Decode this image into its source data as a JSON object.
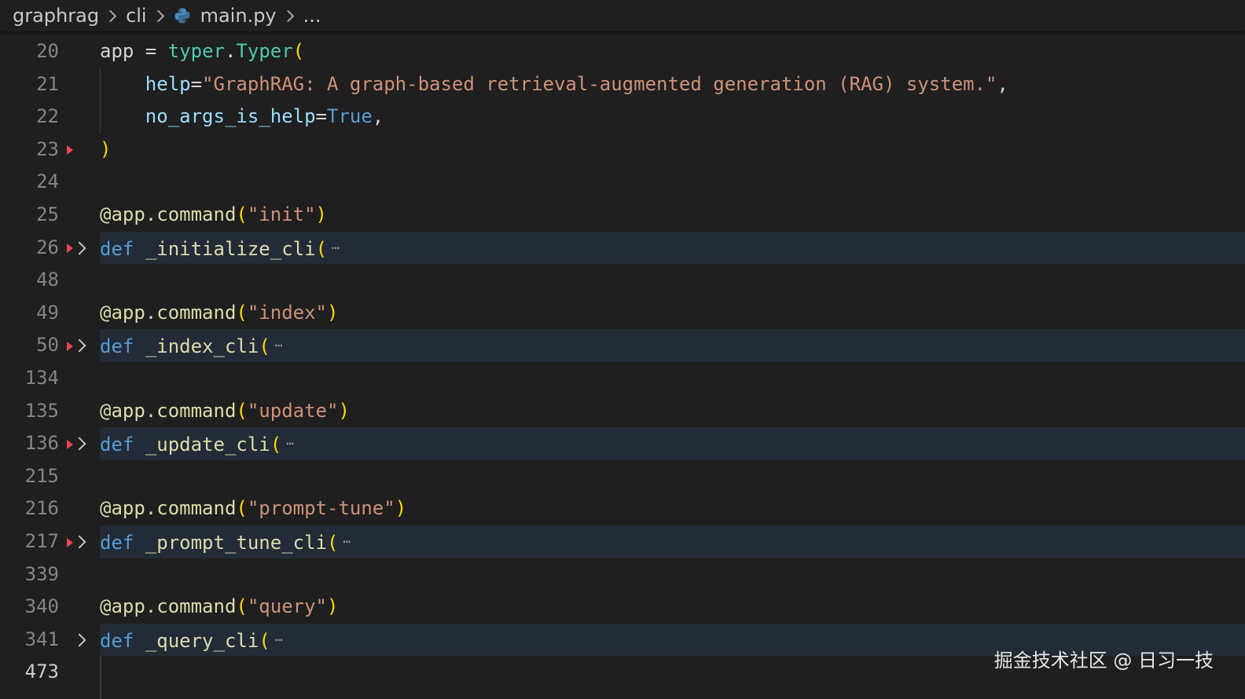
{
  "breadcrumb": {
    "items": [
      "graphrag",
      "cli",
      "main.py",
      "..."
    ],
    "file_icon": "python-icon"
  },
  "colors": {
    "background": "#1f1f1f",
    "folded_highlight": "#232b38",
    "diff_marker": "#e5484d",
    "keyword": "#569cd6",
    "string": "#ce9178",
    "function": "#dcdcaa",
    "class": "#4ec9b0",
    "bracket": "#ffd700"
  },
  "editor": {
    "lines": [
      {
        "num": "20",
        "tokens": [
          {
            "t": "app",
            "c": "tk-var"
          },
          {
            "t": " = ",
            "c": "tk-op"
          },
          {
            "t": "typer",
            "c": "tk-mod"
          },
          {
            "t": ".",
            "c": "tk-op"
          },
          {
            "t": "Typer",
            "c": "tk-cls"
          },
          {
            "t": "(",
            "c": "tk-br"
          }
        ]
      },
      {
        "num": "21",
        "tokens": [
          {
            "t": "    help",
            "c": "tk-name"
          },
          {
            "t": "=",
            "c": "tk-op"
          },
          {
            "t": "\"GraphRAG: A graph-based retrieval-augmented generation (RAG) system.\"",
            "c": "tk-str"
          },
          {
            "t": ",",
            "c": "tk-op"
          }
        ]
      },
      {
        "num": "22",
        "tokens": [
          {
            "t": "    no_args_is_help",
            "c": "tk-name"
          },
          {
            "t": "=",
            "c": "tk-op"
          },
          {
            "t": "True",
            "c": "tk-kw"
          },
          {
            "t": ",",
            "c": "tk-op"
          }
        ]
      },
      {
        "num": "23",
        "tokens": [
          {
            "t": ")",
            "c": "tk-br"
          }
        ]
      },
      {
        "num": "24",
        "tokens": [],
        "diff_marker": true
      },
      {
        "num": "25",
        "tokens": [
          {
            "t": "@app.command",
            "c": "tk-dec"
          },
          {
            "t": "(",
            "c": "tk-br"
          },
          {
            "t": "\"init\"",
            "c": "tk-str"
          },
          {
            "t": ")",
            "c": "tk-br"
          }
        ]
      },
      {
        "num": "26",
        "folded": true,
        "tokens": [
          {
            "t": "def",
            "c": "tk-kw"
          },
          {
            "t": " ",
            "c": "tk-op"
          },
          {
            "t": "_initialize_cli",
            "c": "tk-fn"
          },
          {
            "t": "(",
            "c": "tk-br"
          }
        ]
      },
      {
        "num": "48",
        "tokens": [],
        "diff_marker": true
      },
      {
        "num": "49",
        "tokens": [
          {
            "t": "@app.command",
            "c": "tk-dec"
          },
          {
            "t": "(",
            "c": "tk-br"
          },
          {
            "t": "\"index\"",
            "c": "tk-str"
          },
          {
            "t": ")",
            "c": "tk-br"
          }
        ]
      },
      {
        "num": "50",
        "folded": true,
        "tokens": [
          {
            "t": "def",
            "c": "tk-kw"
          },
          {
            "t": " ",
            "c": "tk-op"
          },
          {
            "t": "_index_cli",
            "c": "tk-fn"
          },
          {
            "t": "(",
            "c": "tk-br"
          }
        ]
      },
      {
        "num": "134",
        "tokens": [],
        "diff_marker": true
      },
      {
        "num": "135",
        "tokens": [
          {
            "t": "@app.command",
            "c": "tk-dec"
          },
          {
            "t": "(",
            "c": "tk-br"
          },
          {
            "t": "\"update\"",
            "c": "tk-str"
          },
          {
            "t": ")",
            "c": "tk-br"
          }
        ]
      },
      {
        "num": "136",
        "folded": true,
        "tokens": [
          {
            "t": "def",
            "c": "tk-kw"
          },
          {
            "t": " ",
            "c": "tk-op"
          },
          {
            "t": "_update_cli",
            "c": "tk-fn"
          },
          {
            "t": "(",
            "c": "tk-br"
          }
        ]
      },
      {
        "num": "215",
        "tokens": [],
        "diff_marker": true
      },
      {
        "num": "216",
        "tokens": [
          {
            "t": "@app.command",
            "c": "tk-dec"
          },
          {
            "t": "(",
            "c": "tk-br"
          },
          {
            "t": "\"prompt-tune\"",
            "c": "tk-str"
          },
          {
            "t": ")",
            "c": "tk-br"
          }
        ]
      },
      {
        "num": "217",
        "folded": true,
        "tokens": [
          {
            "t": "def",
            "c": "tk-kw"
          },
          {
            "t": " ",
            "c": "tk-op"
          },
          {
            "t": "_prompt_tune_cli",
            "c": "tk-fn"
          },
          {
            "t": "(",
            "c": "tk-br"
          }
        ]
      },
      {
        "num": "339",
        "tokens": [],
        "diff_marker": true
      },
      {
        "num": "340",
        "tokens": [
          {
            "t": "@app.command",
            "c": "tk-dec"
          },
          {
            "t": "(",
            "c": "tk-br"
          },
          {
            "t": "\"query\"",
            "c": "tk-str"
          },
          {
            "t": ")",
            "c": "tk-br"
          }
        ]
      },
      {
        "num": "341",
        "folded": true,
        "tokens": [
          {
            "t": "def",
            "c": "tk-kw"
          },
          {
            "t": " ",
            "c": "tk-op"
          },
          {
            "t": "_query_cli",
            "c": "tk-fn"
          },
          {
            "t": "(",
            "c": "tk-br"
          }
        ]
      },
      {
        "num": "473",
        "active": true,
        "tokens": []
      }
    ],
    "fold_ellipsis": "⋯"
  },
  "watermark": "掘金技术社区 @ 日习一技"
}
